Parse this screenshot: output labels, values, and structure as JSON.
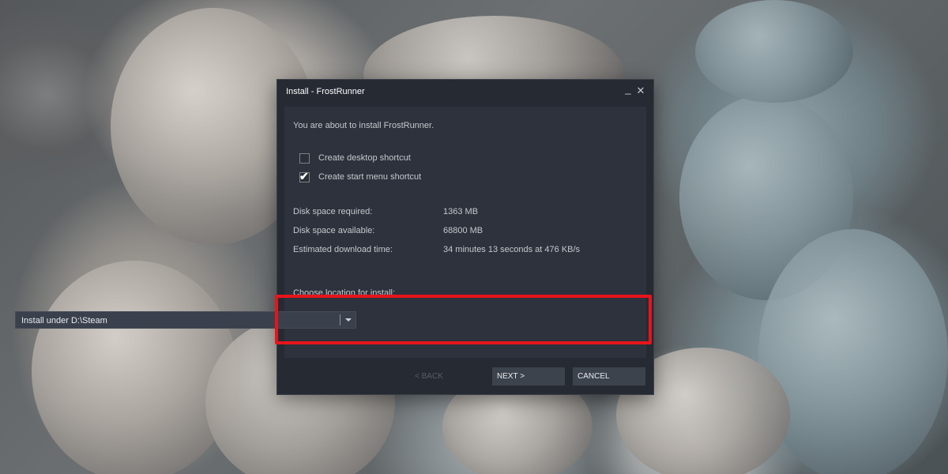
{
  "window": {
    "title": "Install - FrostRunner",
    "minimize_glyph": "_",
    "close_glyph": "✕"
  },
  "intro_text": "You are about to install FrostRunner.",
  "options": [
    {
      "label": "Create desktop shortcut",
      "checked": false
    },
    {
      "label": "Create start menu shortcut",
      "checked": true
    }
  ],
  "info": [
    {
      "label": "Disk space required:",
      "value": "1363 MB"
    },
    {
      "label": "Disk space available:",
      "value": "68800 MB"
    },
    {
      "label": "Estimated download time:",
      "value": "34 minutes 13 seconds at 476 KB/s"
    }
  ],
  "location": {
    "label": "Choose location for install:",
    "selected": "Install under D:\\Steam"
  },
  "buttons": {
    "back": "< BACK",
    "next": "NEXT >",
    "cancel": "CANCEL"
  },
  "colors": {
    "highlight": "#e8141b",
    "dialog_bg": "#262a33",
    "panel_bg": "#2d323c"
  },
  "icons": {
    "checkmark": "checkmark-icon",
    "dropdown": "chevron-down-icon"
  }
}
